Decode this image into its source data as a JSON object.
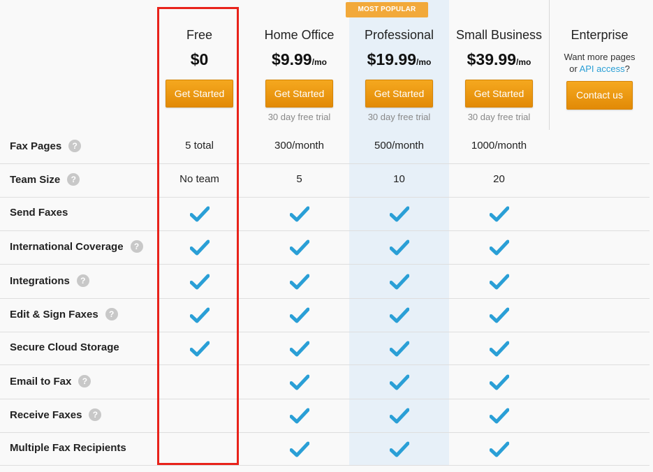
{
  "badge": "MOST POPULAR",
  "plans": [
    {
      "name": "Free",
      "price": "$0",
      "per": "",
      "button": "Get Started",
      "trial": ""
    },
    {
      "name": "Home Office",
      "price": "$9.99",
      "per": "/mo",
      "button": "Get Started",
      "trial": "30 day free trial"
    },
    {
      "name": "Professional",
      "price": "$19.99",
      "per": "/mo",
      "button": "Get Started",
      "trial": "30 day free trial"
    },
    {
      "name": "Small Business",
      "price": "$39.99",
      "per": "/mo",
      "button": "Get Started",
      "trial": "30 day free trial"
    }
  ],
  "enterprise": {
    "name": "Enterprise",
    "desc_line1": "Want more pages",
    "desc_pre": "or ",
    "desc_link": "API access",
    "desc_post": "?",
    "button": "Contact us"
  },
  "help_glyph": "?",
  "features": [
    {
      "label": "Fax Pages",
      "help": true,
      "values": [
        "5 total",
        "300/month",
        "500/month",
        "1000/month"
      ]
    },
    {
      "label": "Team Size",
      "help": true,
      "values": [
        "No team",
        "5",
        "10",
        "20"
      ]
    },
    {
      "label": "Send Faxes",
      "help": false,
      "values": [
        true,
        true,
        true,
        true
      ]
    },
    {
      "label": "International Coverage",
      "help": true,
      "values": [
        true,
        true,
        true,
        true
      ]
    },
    {
      "label": "Integrations",
      "help": true,
      "values": [
        true,
        true,
        true,
        true
      ]
    },
    {
      "label": "Edit & Sign Faxes",
      "help": true,
      "values": [
        true,
        true,
        true,
        true
      ]
    },
    {
      "label": "Secure Cloud Storage",
      "help": false,
      "values": [
        true,
        true,
        true,
        true
      ]
    },
    {
      "label": "Email to Fax",
      "help": true,
      "values": [
        false,
        true,
        true,
        true
      ]
    },
    {
      "label": "Receive Faxes",
      "help": true,
      "values": [
        false,
        true,
        true,
        true
      ]
    },
    {
      "label": "Multiple Fax Recipients",
      "help": false,
      "values": [
        false,
        true,
        true,
        true
      ]
    }
  ],
  "colors": {
    "accent": "#f2a93a",
    "check": "#2a9fd6",
    "highlight": "#e8231b",
    "popular_bg": "#e7f0f8"
  }
}
